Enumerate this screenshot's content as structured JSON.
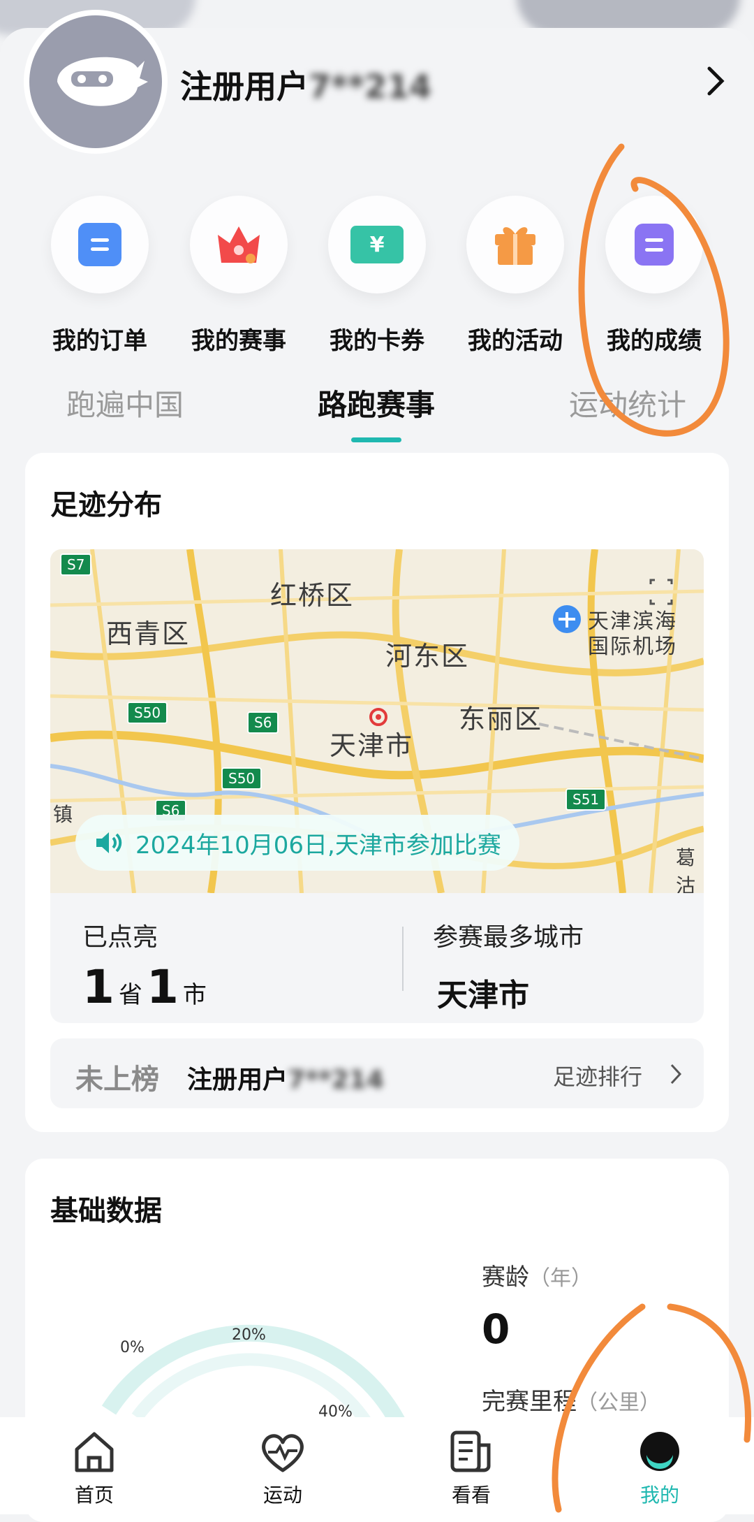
{
  "profile": {
    "username": "注册用户",
    "masked_id": "7**214"
  },
  "shortcuts": [
    {
      "label": "我的订单",
      "icon": "order-icon",
      "color": "#4f8ff7"
    },
    {
      "label": "我的赛事",
      "icon": "crown-icon",
      "color": "#f24a4a"
    },
    {
      "label": "我的卡券",
      "icon": "coupon-icon",
      "color": "#36c3a6"
    },
    {
      "label": "我的活动",
      "icon": "gift-icon",
      "color": "#f59a45"
    },
    {
      "label": "我的成绩",
      "icon": "score-icon",
      "color": "#8a74f3"
    }
  ],
  "tabs": [
    {
      "label": "跑遍中国"
    },
    {
      "label": "路跑赛事"
    },
    {
      "label": "运动统计"
    }
  ],
  "footprint": {
    "title": "足迹分布",
    "map_labels": [
      "西青区",
      "红桥区",
      "河东区",
      "东丽区",
      "天津市",
      "天津滨海",
      "国际机场",
      "镇",
      "葛沽"
    ],
    "highways": [
      "S7",
      "S50",
      "S6",
      "S50",
      "S6",
      "S51"
    ],
    "notice": "2024年10月06日,天津市参加比赛",
    "lit_label": "已点亮",
    "province_count": "1",
    "province_unit": "省",
    "city_count": "1",
    "city_unit": "市",
    "top_city_label": "参赛最多城市",
    "top_city": "天津市"
  },
  "rank": {
    "status": "未上榜",
    "username": "注册用户",
    "masked_id": "7**214",
    "link": "足迹排行"
  },
  "basic": {
    "title": "基础数据",
    "gauge_ticks": [
      "0%",
      "20%",
      "40%"
    ],
    "age_label": "赛龄",
    "age_unit": "（年）",
    "age_value": "0",
    "distance_label": "完赛里程",
    "distance_unit": "（公里）"
  },
  "nav": [
    {
      "label": "首页",
      "icon": "home-icon"
    },
    {
      "label": "运动",
      "icon": "heart-pulse-icon"
    },
    {
      "label": "看看",
      "icon": "news-icon"
    },
    {
      "label": "我的",
      "icon": "profile-face-icon",
      "active": true
    }
  ],
  "colors": {
    "accent": "#1fb8b0",
    "annotation": "#f28a3b"
  }
}
